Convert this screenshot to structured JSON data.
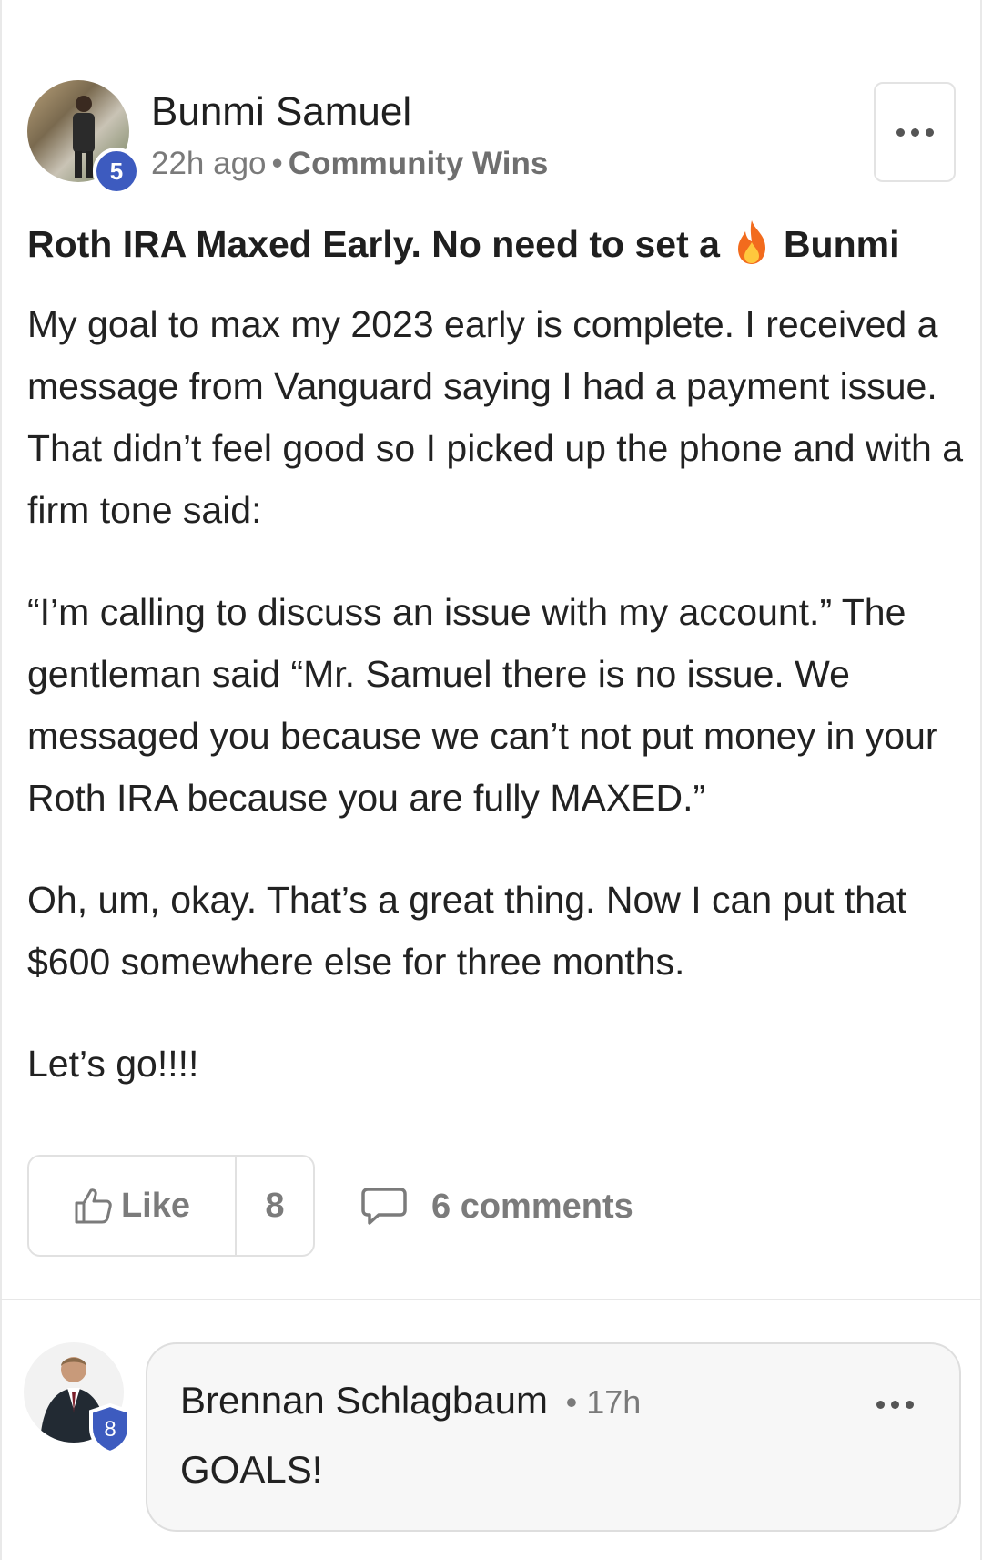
{
  "post": {
    "author": "Bunmi Samuel",
    "level": "5",
    "time": "22h ago",
    "separator": "•",
    "category": "Community Wins",
    "title_before": "Roth IRA Maxed Early. No need to set a",
    "title_after": "Bunmi",
    "title_icon": "fire-icon",
    "paragraphs": [
      "My goal to max my 2023 early is complete. I received a message from Vanguard saying I had a payment issue. That didn’t feel good so I picked up the phone and with a firm tone said:",
      "“I’m calling to discuss an issue with my account.” The gentleman said “Mr. Samuel there is no issue. We messaged you because we can’t not put money in your Roth IRA because you are fully MAXED.”",
      "Oh, um, okay. That’s a great thing. Now I can put that $600 somewhere else for three months.",
      "Let’s go!!!!"
    ],
    "like_label": "Like",
    "like_count": "8",
    "comments_label": "6 comments"
  },
  "comment": {
    "author": "Brennan Schlagbaum",
    "separator": "•",
    "time": "17h",
    "level": "8",
    "text": "GOALS!"
  },
  "colors": {
    "badge_blue": "#3d5bbf",
    "muted_text": "#7a7a7a",
    "border": "#e1e1e1",
    "fire_orange": "#f26b1d"
  }
}
